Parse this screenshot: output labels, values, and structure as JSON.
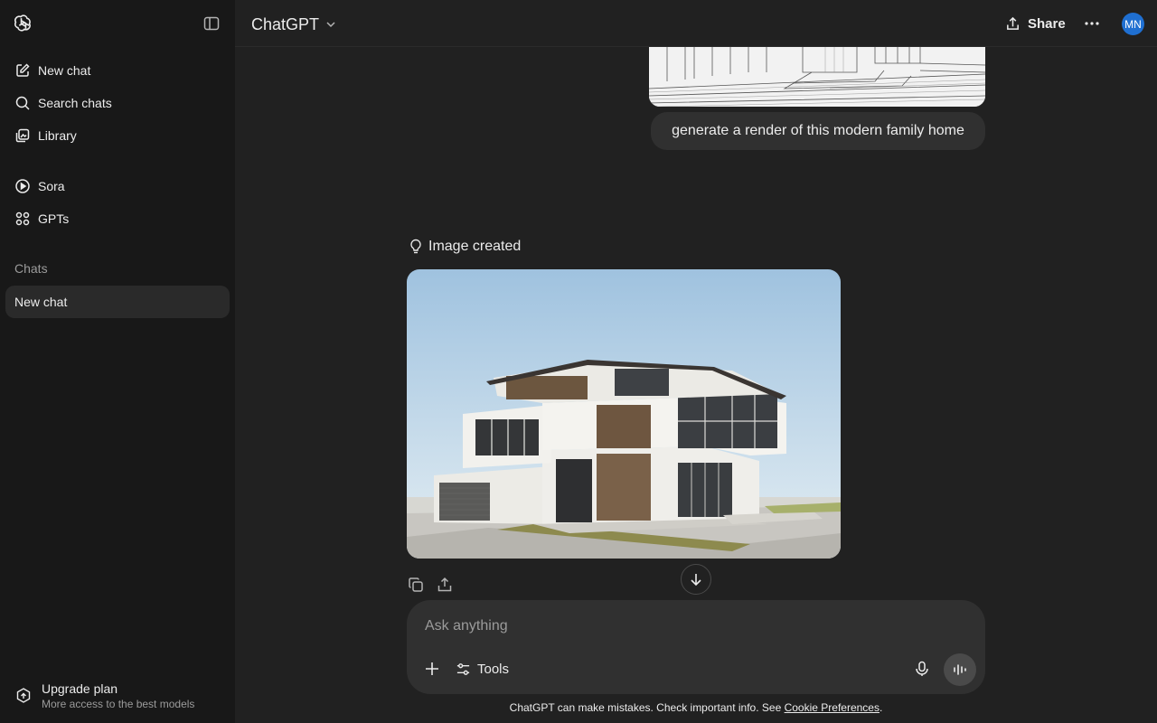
{
  "sidebar": {
    "items": [
      {
        "label": "New chat",
        "icon": "new-chat-icon"
      },
      {
        "label": "Search chats",
        "icon": "search-icon"
      },
      {
        "label": "Library",
        "icon": "library-icon"
      },
      {
        "label": "Sora",
        "icon": "play-icon"
      },
      {
        "label": "GPTs",
        "icon": "grid-icon"
      }
    ],
    "section_label": "Chats",
    "chats": [
      {
        "label": "New chat"
      }
    ],
    "upgrade": {
      "title": "Upgrade plan",
      "subtitle": "More access to the best models"
    }
  },
  "header": {
    "model": "ChatGPT",
    "share_label": "Share",
    "avatar_initials": "MN"
  },
  "conversation": {
    "user_message": "generate a render of this modern family home",
    "status": "Image created"
  },
  "composer": {
    "placeholder": "Ask anything",
    "tools_label": "Tools"
  },
  "footer": {
    "disclaimer": "ChatGPT can make mistakes. Check important info. See ",
    "link": "Cookie Preferences",
    "end": "."
  },
  "colors": {
    "background": "#212121",
    "sidebar": "#181818",
    "bubble": "#303030",
    "avatar": "#1f6fd1"
  }
}
